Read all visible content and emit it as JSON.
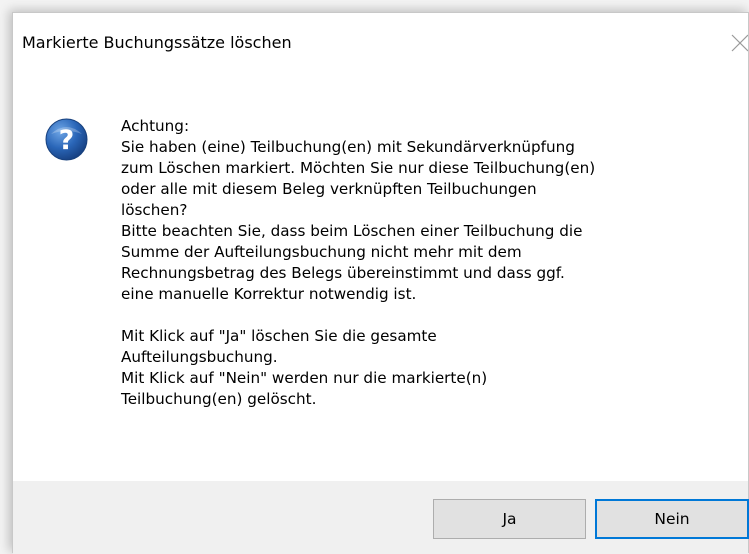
{
  "window": {
    "title": "Markierte Buchungssätze löschen",
    "close_icon": "close-icon"
  },
  "message": {
    "icon": "question-icon",
    "lines": [
      "Achtung:",
      "Sie haben (eine) Teilbuchung(en) mit Sekundärverknüpfung",
      "zum Löschen markiert. Möchten Sie nur diese Teilbuchung(en)",
      "oder alle mit diesem Beleg verknüpften Teilbuchungen",
      "löschen?",
      "Bitte beachten Sie, dass beim Löschen einer Teilbuchung die",
      "Summe der Aufteilungsbuchung nicht mehr mit dem",
      "Rechnungsbetrag des Belegs übereinstimmt und dass ggf.",
      "eine manuelle Korrektur notwendig ist.",
      "",
      "Mit Klick auf \"Ja\" löschen Sie die gesamte",
      "Aufteilungsbuchung.",
      "Mit Klick auf \"Nein\" werden nur die markierte(n)",
      "Teilbuchung(en) gelöscht."
    ]
  },
  "buttons": {
    "yes_label": "Ja",
    "no_label": "Nein"
  },
  "colors": {
    "focus_border": "#0078d7",
    "icon_blue": "#1f5fae"
  }
}
